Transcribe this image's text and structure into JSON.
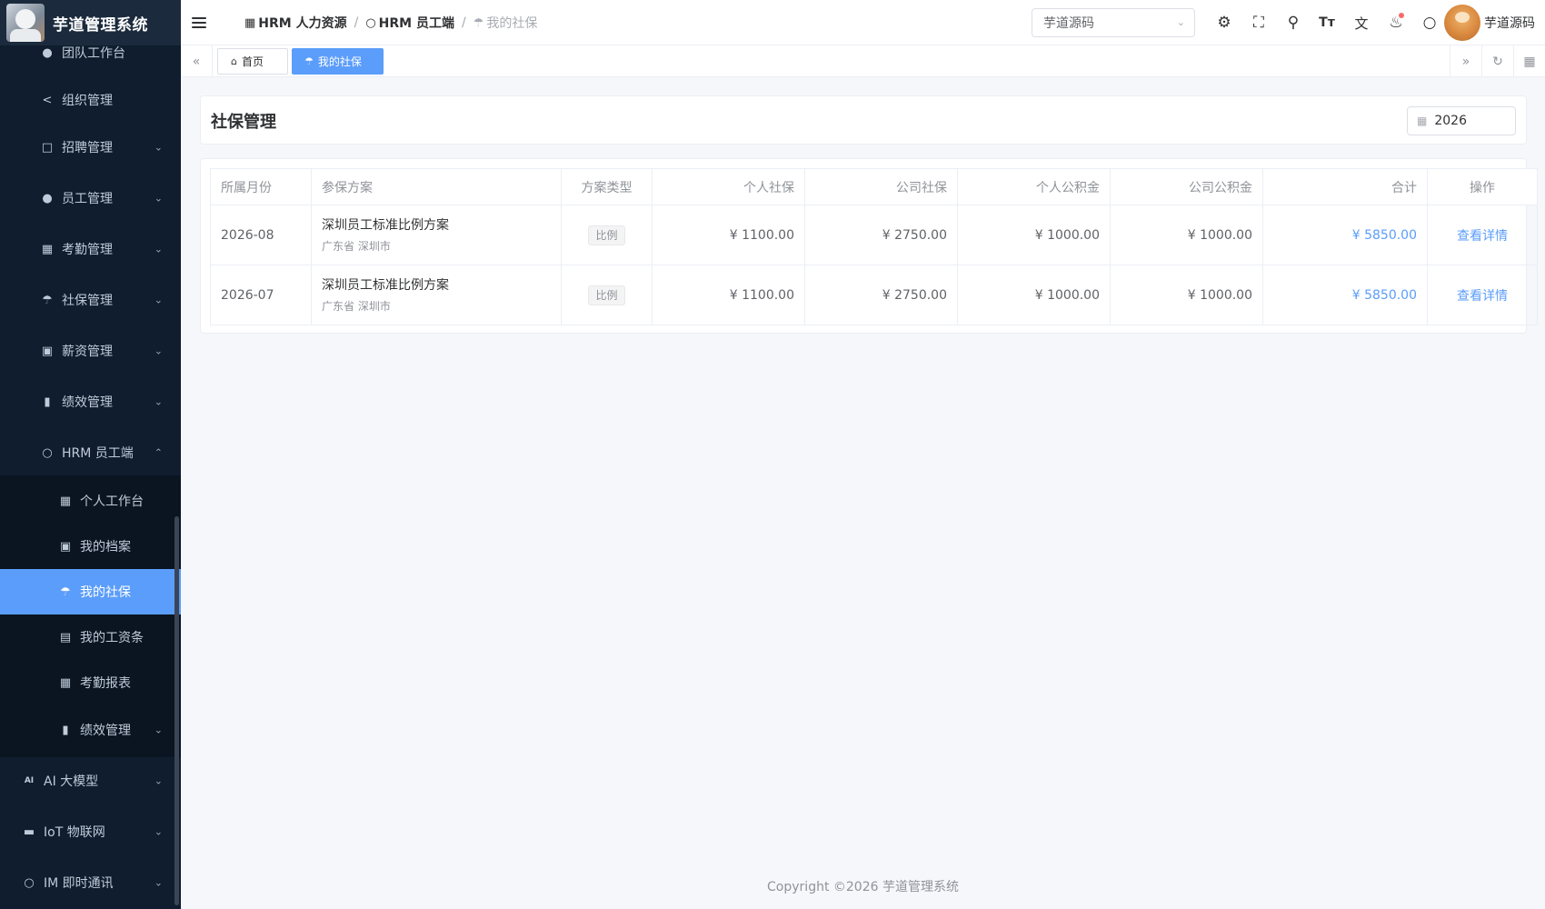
{
  "app": {
    "title": "芋道管理系统"
  },
  "sidebar": {
    "items": [
      {
        "label": "团队工作台",
        "icon": "user-icon"
      },
      {
        "label": "组织管理",
        "icon": "share-icon"
      },
      {
        "label": "招聘管理",
        "icon": "briefcase-icon"
      },
      {
        "label": "员工管理",
        "icon": "user-icon"
      },
      {
        "label": "考勤管理",
        "icon": "calendar-icon"
      },
      {
        "label": "社保管理",
        "icon": "umbrella-icon"
      },
      {
        "label": "薪资管理",
        "icon": "money-icon"
      },
      {
        "label": "绩效管理",
        "icon": "bar-chart-icon"
      },
      {
        "label": "HRM 员工端",
        "icon": "user-outline-icon"
      }
    ],
    "sub_items": [
      {
        "label": "个人工作台",
        "icon": "calendar-icon"
      },
      {
        "label": "我的档案",
        "icon": "profile-icon"
      },
      {
        "label": "我的社保",
        "icon": "umbrella-icon"
      },
      {
        "label": "我的工资条",
        "icon": "document-icon"
      },
      {
        "label": "考勤报表",
        "icon": "calendar-icon"
      },
      {
        "label": "绩效管理",
        "icon": "bar-chart-icon"
      }
    ],
    "bottom_items": [
      {
        "label": "AI 大模型",
        "icon": "ai-icon"
      },
      {
        "label": "IoT 物联网",
        "icon": "car-icon"
      },
      {
        "label": "IM 即时通讯",
        "icon": "chat-icon"
      }
    ]
  },
  "header": {
    "breadcrumb": [
      "HRM 人力资源",
      "HRM 员工端",
      "我的社保"
    ],
    "tenant": "芋道源码",
    "user": "芋道源码"
  },
  "tags": {
    "home": "首页",
    "current": "我的社保"
  },
  "page": {
    "title": "社保管理",
    "year": "2026"
  },
  "table": {
    "columns": [
      "所属月份",
      "参保方案",
      "方案类型",
      "个人社保",
      "公司社保",
      "个人公积金",
      "公司公积金",
      "合计",
      "操作"
    ],
    "rows": [
      {
        "month": "2026-08",
        "plan": "深圳员工标准比例方案",
        "region": "广东省 深圳市",
        "type": "比例",
        "personal_social": "¥ 1100.00",
        "company_social": "¥ 2750.00",
        "personal_fund": "¥ 1000.00",
        "company_fund": "¥ 1000.00",
        "total": "¥ 5850.00",
        "action": "查看详情"
      },
      {
        "month": "2026-07",
        "plan": "深圳员工标准比例方案",
        "region": "广东省 深圳市",
        "type": "比例",
        "personal_social": "¥ 1100.00",
        "company_social": "¥ 2750.00",
        "personal_fund": "¥ 1000.00",
        "company_fund": "¥ 1000.00",
        "total": "¥ 5850.00",
        "action": "查看详情"
      }
    ]
  },
  "footer": {
    "copyright": "Copyright ©2026 芋道管理系统"
  },
  "colors": {
    "accent": "#5b9dfa",
    "sidebar_bg": "#0f1d2e"
  }
}
